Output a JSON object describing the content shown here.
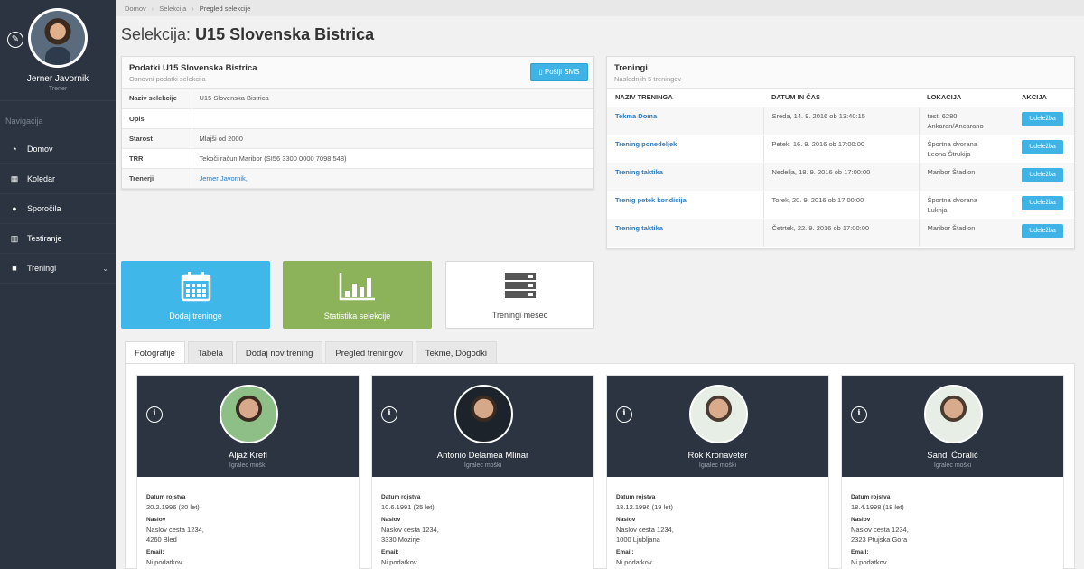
{
  "sidebar": {
    "user_name": "Jerner Javornik",
    "user_role": "Trener",
    "nav_title": "Navigacija",
    "items": [
      {
        "label": "Domov",
        "icon": "dashboard-icon"
      },
      {
        "label": "Koledar",
        "icon": "calendar-icon"
      },
      {
        "label": "Sporočila",
        "icon": "chat-icon"
      },
      {
        "label": "Testiranje",
        "icon": "bar-chart-icon"
      },
      {
        "label": "Treningi",
        "icon": "bookmark-icon"
      }
    ]
  },
  "breadcrumb": [
    "Domov",
    "Selekcija",
    "Pregled selekcije"
  ],
  "page": {
    "title_prefix": "Selekcija:",
    "title_name": "U15 Slovenska Bistrica"
  },
  "info_panel": {
    "title": "Podatki U15 Slovenska Bistrica",
    "subtitle": "Osnovni podatki selekcija",
    "sms_button": "Pošlji SMS",
    "rows": [
      {
        "label": "Naziv selekcije",
        "value": "U15 Slovenska Bistrica"
      },
      {
        "label": "Opis",
        "value": ""
      },
      {
        "label": "Starost",
        "value": "Mlajši od 2000"
      },
      {
        "label": "TRR",
        "value": "Tekoči račun Maribor (SI56 3300 0000 7098 548)"
      },
      {
        "label": "Trenerji",
        "value": "Jerner Javornik,"
      }
    ]
  },
  "trainings_panel": {
    "title": "Treningi",
    "subtitle": "Naslednjih 5 treningov",
    "headers": [
      "NAZIV TRENINGA",
      "DATUM IN ČAS",
      "LOKACIJA",
      "AKCIJA"
    ],
    "rows": [
      {
        "name": "Tekma Doma",
        "date": "Sreda, 14. 9. 2016 ob 13:40:15",
        "loc1": "test, 6280",
        "loc2": "Ankaran/Ancarano",
        "action": "Udeležba"
      },
      {
        "name": "Trening ponedeljek",
        "date": "Petek, 16. 9. 2016 ob 17:00:00",
        "loc1": "Športna dvorana",
        "loc2": "Leona Štrukija",
        "action": "Udeležba"
      },
      {
        "name": "Trening taktika",
        "date": "Nedelja, 18. 9. 2016 ob 17:00:00",
        "loc1": "Maribor Štadion",
        "loc2": "",
        "action": "Udeležba"
      },
      {
        "name": "Trenig petek kondicija",
        "date": "Torek, 20. 9. 2016 ob 17:00:00",
        "loc1": "Športna dvorana",
        "loc2": "Luknja",
        "action": "Udeležba"
      },
      {
        "name": "Trening taktika",
        "date": "Četrtek, 22. 9. 2016 ob 17:00:00",
        "loc1": "Maribor Štadion",
        "loc2": "",
        "action": "Udeležba"
      }
    ]
  },
  "tiles": [
    {
      "label": "Dodaj treninge",
      "icon": "calendar-icon",
      "color": "#3fb8e9"
    },
    {
      "label": "Statistika selekcije",
      "icon": "bar-chart-icon",
      "color": "#8cb35a"
    },
    {
      "label": "Treningi mesec",
      "icon": "list-icon",
      "color": "#ffffff"
    }
  ],
  "tabs": [
    "Fotografije",
    "Tabela",
    "Dodaj nov trening",
    "Pregled treningov",
    "Tekme, Dogodki"
  ],
  "players": [
    {
      "name": "Aljaž Krefl",
      "role": "Igralec moški",
      "dob_label": "Datum rojstva",
      "dob": "20.2.1996 (20 let)",
      "addr_label": "Naslov",
      "addr1": "Naslov cesta 1234,",
      "addr2": "4260 Bled",
      "email_label": "Email:",
      "email": "Ni podatkov"
    },
    {
      "name": "Antonio Delamea Mlinar",
      "role": "Igralec moški",
      "dob_label": "Datum rojstva",
      "dob": "10.6.1991 (25 let)",
      "addr_label": "Naslov",
      "addr1": "Naslov cesta 1234,",
      "addr2": "3330 Mozirje",
      "email_label": "Email:",
      "email": "Ni podatkov"
    },
    {
      "name": "Rok Kronaveter",
      "role": "Igralec moški",
      "dob_label": "Datum rojstva",
      "dob": "18.12.1996 (19 let)",
      "addr_label": "Naslov",
      "addr1": "Naslov cesta 1234,",
      "addr2": "1000 Ljubljana",
      "email_label": "Email:",
      "email": "Ni podatkov"
    },
    {
      "name": "Sandi Ćoralić",
      "role": "Igralec moški",
      "dob_label": "Datum rojstva",
      "dob": "18.4.1998 (18 let)",
      "addr_label": "Naslov",
      "addr1": "Naslov cesta 1234,",
      "addr2": "2323 Ptujska Gora",
      "email_label": "Email:",
      "email": "Ni podatkov"
    }
  ]
}
